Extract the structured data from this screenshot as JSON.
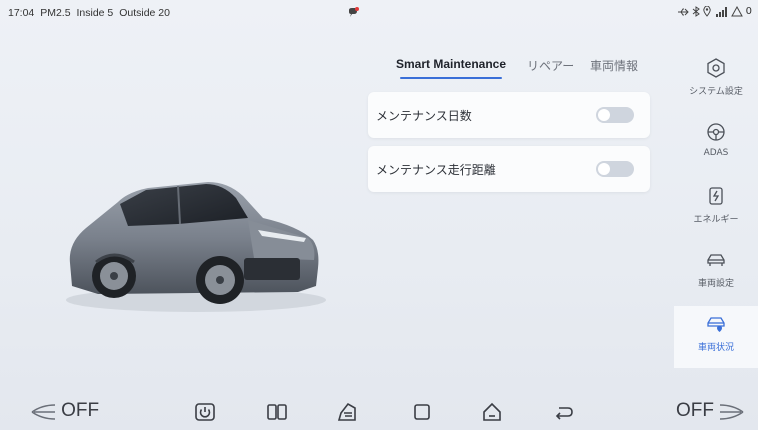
{
  "status_bar": {
    "time": "17:04",
    "pm25": "PM2.5",
    "inside": "Inside 5",
    "outside": "Outside 20",
    "right_text": "0"
  },
  "tabs": [
    {
      "label": "Smart Maintenance",
      "active": true
    },
    {
      "label": "リペアー",
      "active": false
    },
    {
      "label": "車両情報",
      "active": false
    }
  ],
  "settings": [
    {
      "label": "メンテナンス日数",
      "enabled": false
    },
    {
      "label": "メンテナンス走行距離",
      "enabled": false
    }
  ],
  "sidebar": {
    "items": [
      {
        "label": "システム設定",
        "icon": "system-settings-icon",
        "active": false
      },
      {
        "label": "ADAS",
        "icon": "steering-wheel-icon",
        "active": false
      },
      {
        "label": "エネルギー",
        "icon": "energy-icon",
        "active": false
      },
      {
        "label": "車両設定",
        "icon": "car-settings-icon",
        "active": false
      },
      {
        "label": "車両状況",
        "icon": "car-status-icon",
        "active": true
      }
    ]
  },
  "bottom_bar": {
    "left_fan": "OFF",
    "right_fan": "OFF"
  },
  "colors": {
    "accent": "#3a6fd8",
    "background": "#e9edf3",
    "card": "#fbfcfd",
    "toggle_off": "#cfd5de"
  }
}
